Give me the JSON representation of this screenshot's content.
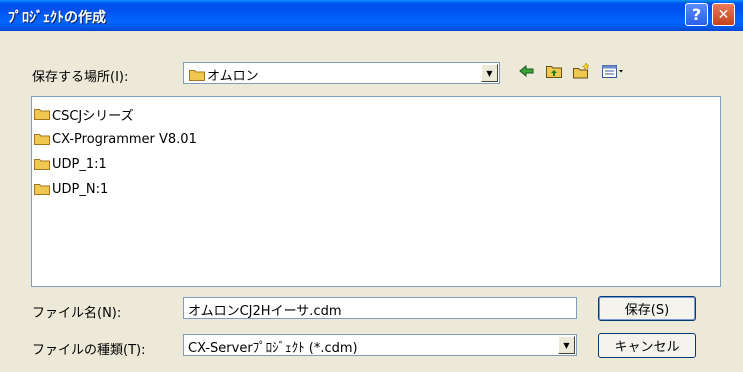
{
  "window": {
    "title": "ﾌﾟﾛｼﾞｪｸﾄの作成",
    "help_label": "?",
    "close_label": "✕"
  },
  "location": {
    "label": "保存する場所(I):",
    "value": "オムロン",
    "icons": [
      "back-arrow-icon",
      "up-folder-icon",
      "new-folder-icon",
      "view-menu-icon"
    ]
  },
  "files": [
    {
      "name": "CSCJシリーズ"
    },
    {
      "name": "CX-Programmer V8.01"
    },
    {
      "name": "UDP_1:1"
    },
    {
      "name": "UDP_N:1"
    }
  ],
  "filename": {
    "label": "ファイル名(N):",
    "value": "オムロンCJ2Hイーサ.cdm"
  },
  "filetype": {
    "label": "ファイルの種類(T):",
    "value": "CX-Serverﾌﾟﾛｼﾞｪｸﾄ (*.cdm)"
  },
  "buttons": {
    "save": "保存(S)",
    "cancel": "キャンセル"
  },
  "colors": {
    "title_bar": "#0054e3",
    "dialog_bg": "#ece9d8",
    "folder": "#f0c850"
  }
}
